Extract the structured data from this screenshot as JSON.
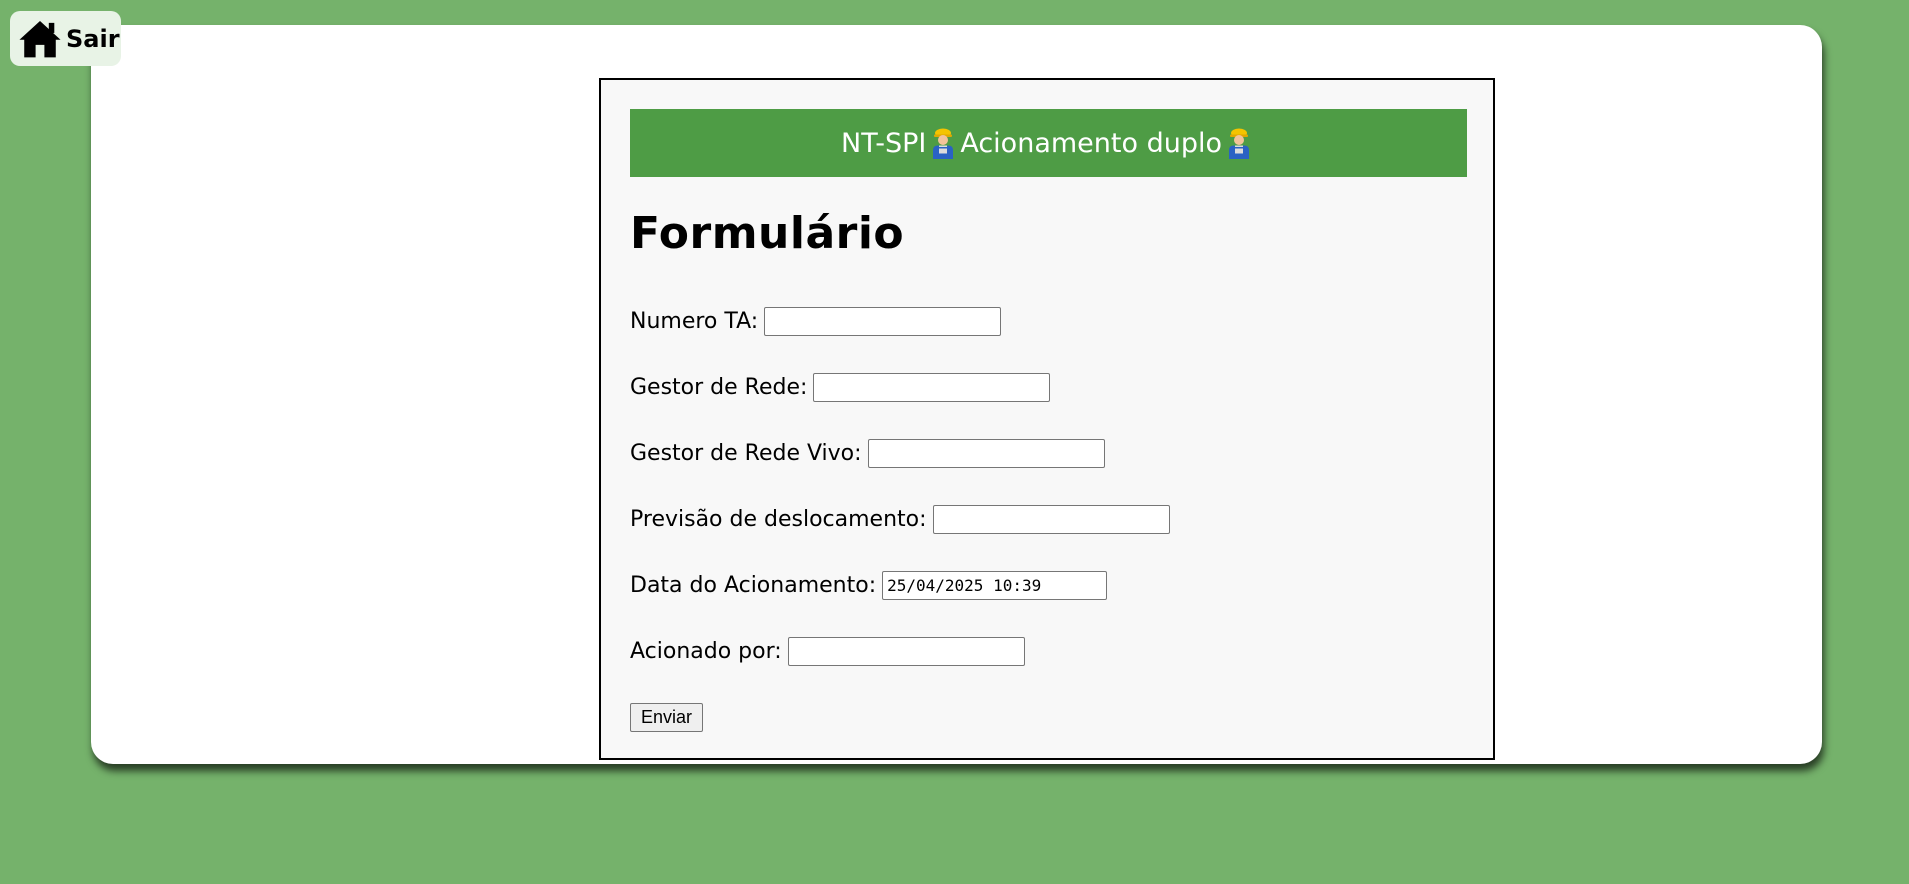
{
  "nav": {
    "exit_label": "Sair",
    "icon": "home-icon"
  },
  "banner": {
    "title_prefix": "NT-SPI",
    "title_main": "Acionamento duplo",
    "icon": "worker-icon"
  },
  "form": {
    "title": "Formulário",
    "fields": [
      {
        "label": "Numero TA:",
        "value": ""
      },
      {
        "label": "Gestor de Rede:",
        "value": ""
      },
      {
        "label": "Gestor de Rede Vivo:",
        "value": ""
      },
      {
        "label": "Previsão de deslocamento:",
        "value": ""
      },
      {
        "label": "Data do Acionamento:",
        "value": "25/04/2025 10:39"
      },
      {
        "label": "Acionado por:",
        "value": ""
      }
    ],
    "submit_label": "Enviar"
  },
  "colors": {
    "background": "#75b26b",
    "banner": "#4e9c45",
    "card": "#ffffff",
    "form_box": "#f8f8f8"
  }
}
